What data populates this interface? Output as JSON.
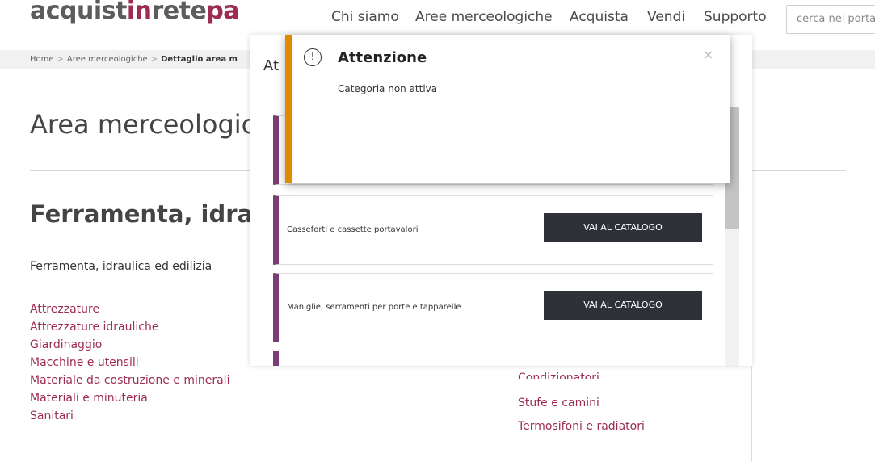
{
  "header": {
    "logo": {
      "part1": "acquist",
      "part2": "in",
      "part3": "rete",
      "part4": "pa"
    },
    "nav": [
      "Chi siamo",
      "Aree merceologiche",
      "Acquista",
      "Vendi",
      "Supporto"
    ],
    "search_placeholder": "cerca nel portale"
  },
  "breadcrumb": {
    "home": "Home",
    "level1": "Aree merceologiche",
    "current": "Dettaglio area m"
  },
  "main": {
    "area_title": "Area merceologica",
    "section_title": "Ferramenta, idraulica",
    "subtitle": "Ferramenta, idraulica ed edilizia",
    "left_links": [
      "Attrezzature",
      "Attrezzature idrauliche",
      "Giardinaggio",
      "Macchine e utensili",
      "Materiale da costruzione e minerali",
      "Materiali e minuteria",
      "Sanitari"
    ],
    "right_links_partial": "Condizionatori",
    "right_links": [
      "Stufe e camini",
      "Termosifoni e radiatori"
    ]
  },
  "bg_modal": {
    "title": "At",
    "cards": [
      {
        "label": "",
        "button": ""
      },
      {
        "label": "Casseforti e cassette portavalori",
        "button": "VAI AL CATALOGO"
      },
      {
        "label": "Maniglie, serramenti per porte e tapparelle",
        "button": "VAI AL CATALOGO"
      },
      {
        "label": "",
        "button": ""
      }
    ]
  },
  "alert": {
    "icon": "exclamation-circle-icon",
    "icon_glyph": "!",
    "title": "Attenzione",
    "close_glyph": "×",
    "message": "Categoria non attiva"
  },
  "colors": {
    "accent": "#9c2d50",
    "card_border": "#7b3d74",
    "alert_stripe": "#e08a00",
    "button_bg": "#2e3238"
  }
}
